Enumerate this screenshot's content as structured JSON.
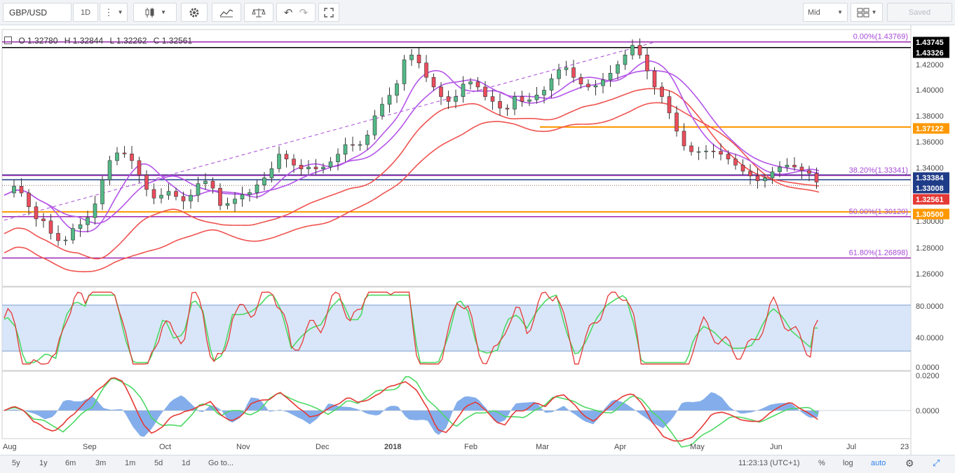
{
  "toolbar": {
    "symbol": "GBP/USD",
    "interval": "1D",
    "price_source": "Mid",
    "saved_label": "Saved",
    "icons": [
      "bars-menu-icon",
      "candlestick-icon",
      "gear-icon",
      "indicators-icon",
      "compare-icon",
      "undo-icon",
      "redo-icon",
      "fullscreen-icon",
      "layout-icon"
    ]
  },
  "legend": {
    "open": "O 1.32780",
    "high": "H 1.32844",
    "low": "L 1.32262",
    "close": "C 1.32561"
  },
  "fib_labels": [
    "0.00%(1.43769)",
    "38.20%(1.33341)",
    "50.00%(1.30120)",
    "61.80%(1.26898)"
  ],
  "price_badges": [
    {
      "text": "1.43745",
      "color": "#000000"
    },
    {
      "text": "1.43326",
      "color": "#000000"
    },
    {
      "text": "1.37122",
      "color": "#ff9800"
    },
    {
      "text": "1.33384",
      "color": "#1f3c88"
    },
    {
      "text": "1.33008",
      "color": "#1f3c88"
    },
    {
      "text": "1.32561",
      "color": "#e53935"
    },
    {
      "text": "1.30500",
      "color": "#ff9800"
    }
  ],
  "chart_data": {
    "type": "candlestick",
    "symbol": "GBP/USD",
    "x_ticks": [
      "Aug",
      "Sep",
      "Oct",
      "Nov",
      "Dec",
      "2018",
      "Feb",
      "Mar",
      "Apr",
      "May",
      "Jun",
      "Jul",
      "23"
    ],
    "y_ticks": [
      "1.42000",
      "1.40000",
      "1.38000",
      "1.36000",
      "1.34000",
      "1.28000",
      "1.26000",
      "1.30000"
    ],
    "ylim": [
      1.2525,
      1.4425
    ],
    "horizontal_lines": [
      {
        "price": 1.43769,
        "color": "#9c27b0",
        "label": "0.00%(1.43769)"
      },
      {
        "price": 1.43326,
        "color": "#000000"
      },
      {
        "price": 1.37122,
        "color": "#ff9800"
      },
      {
        "price": 1.33384,
        "color": "#1f3c88"
      },
      {
        "price": 1.33341,
        "color": "#9c27b0",
        "label": "38.20%(1.33341)"
      },
      {
        "price": 1.33008,
        "color": "#1f3c88"
      },
      {
        "price": 1.305,
        "color": "#ff9800"
      },
      {
        "price": 1.3012,
        "color": "#9c27b0",
        "label": "50.00%(1.30120)"
      },
      {
        "price": 1.26898,
        "color": "#9c27b0",
        "label": "61.80%(1.26898)"
      }
    ],
    "close_path": [
      [
        0,
        1.318
      ],
      [
        8,
        1.325
      ],
      [
        16,
        1.318
      ],
      [
        24,
        1.3
      ],
      [
        32,
        1.298
      ],
      [
        40,
        1.285
      ],
      [
        48,
        1.28
      ],
      [
        56,
        1.292
      ],
      [
        64,
        1.296
      ],
      [
        72,
        1.305
      ],
      [
        80,
        1.33
      ],
      [
        88,
        1.35
      ],
      [
        96,
        1.352
      ],
      [
        104,
        1.345
      ],
      [
        112,
        1.33
      ],
      [
        120,
        1.315
      ],
      [
        128,
        1.318
      ],
      [
        136,
        1.322
      ],
      [
        144,
        1.312
      ],
      [
        152,
        1.318
      ],
      [
        160,
        1.33
      ],
      [
        168,
        1.328
      ],
      [
        176,
        1.31
      ],
      [
        184,
        1.312
      ],
      [
        192,
        1.318
      ],
      [
        200,
        1.32
      ],
      [
        208,
        1.328
      ],
      [
        216,
        1.335
      ],
      [
        224,
        1.35
      ],
      [
        232,
        1.345
      ],
      [
        240,
        1.338
      ],
      [
        248,
        1.34
      ],
      [
        256,
        1.338
      ],
      [
        264,
        1.342
      ],
      [
        272,
        1.35
      ],
      [
        280,
        1.36
      ],
      [
        288,
        1.355
      ],
      [
        296,
        1.365
      ],
      [
        304,
        1.385
      ],
      [
        312,
        1.393
      ],
      [
        320,
        1.405
      ],
      [
        328,
        1.43
      ],
      [
        336,
        1.425
      ],
      [
        344,
        1.41
      ],
      [
        352,
        1.4
      ],
      [
        360,
        1.39
      ],
      [
        368,
        1.395
      ],
      [
        376,
        1.408
      ],
      [
        384,
        1.405
      ],
      [
        392,
        1.395
      ],
      [
        400,
        1.39
      ],
      [
        408,
        1.382
      ],
      [
        416,
        1.395
      ],
      [
        424,
        1.39
      ],
      [
        432,
        1.395
      ],
      [
        440,
        1.4
      ],
      [
        448,
        1.412
      ],
      [
        456,
        1.42
      ],
      [
        464,
        1.41
      ],
      [
        472,
        1.403
      ],
      [
        480,
        1.402
      ],
      [
        488,
        1.408
      ],
      [
        496,
        1.415
      ],
      [
        504,
        1.425
      ],
      [
        512,
        1.435
      ],
      [
        520,
        1.425
      ],
      [
        528,
        1.405
      ],
      [
        536,
        1.395
      ],
      [
        544,
        1.378
      ],
      [
        552,
        1.358
      ],
      [
        560,
        1.352
      ],
      [
        568,
        1.352
      ],
      [
        576,
        1.353
      ],
      [
        584,
        1.35
      ],
      [
        592,
        1.345
      ],
      [
        600,
        1.338
      ],
      [
        608,
        1.333
      ],
      [
        616,
        1.328
      ],
      [
        624,
        1.335
      ],
      [
        632,
        1.34
      ],
      [
        640,
        1.342
      ],
      [
        648,
        1.338
      ],
      [
        656,
        1.335
      ],
      [
        664,
        1.326
      ]
    ],
    "indicators": [
      "SMA",
      "SMA",
      "EMA",
      "EMA",
      "Stochastic",
      "MACD"
    ],
    "stochastic_ticks": [
      "80.0000",
      "40.0000",
      "0.0000"
    ],
    "macd_ticks": [
      "0.0200",
      "0.0000"
    ]
  },
  "bottom": {
    "ranges": [
      "5y",
      "1y",
      "6m",
      "3m",
      "1m",
      "5d",
      "1d"
    ],
    "goto": "Go to...",
    "time": "11:23:13 (UTC+1)",
    "percent": "%",
    "log": "log",
    "auto": "auto"
  }
}
